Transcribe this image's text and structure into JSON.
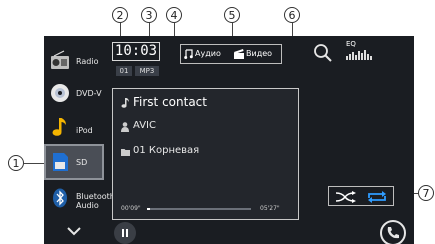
{
  "clock": "10:03",
  "sources": [
    {
      "id": "radio",
      "label": "Radio",
      "icon": "radio-icon"
    },
    {
      "id": "dvdv",
      "label": "DVD-V",
      "icon": "disc-icon"
    },
    {
      "id": "ipod",
      "label": "iPod",
      "icon": "music-note-icon"
    },
    {
      "id": "sd",
      "label": "SD",
      "icon": "sd-card-icon",
      "active": true
    },
    {
      "id": "bluetooth",
      "label": "Bluetooth Audio",
      "icon": "bluetooth-icon"
    }
  ],
  "status": {
    "folder_number": "01",
    "format": "MP3"
  },
  "filters": [
    {
      "label": "Аудио",
      "icon": "audio-note-icon"
    },
    {
      "label": "Видео",
      "icon": "video-clapper-icon"
    }
  ],
  "eq_label": "EQ",
  "track": {
    "title": "First contact",
    "artist": "AVIC",
    "folder": "01 Корневая",
    "elapsed": "00'09\"",
    "total": "05'27\"",
    "progress": 0.03
  },
  "callouts": [
    "1",
    "2",
    "3",
    "4",
    "5",
    "6",
    "7"
  ],
  "colors": {
    "accent_blue": "#2f9cff",
    "screen_bg": "#1a1d22",
    "active_bg": "#4a4e56"
  }
}
